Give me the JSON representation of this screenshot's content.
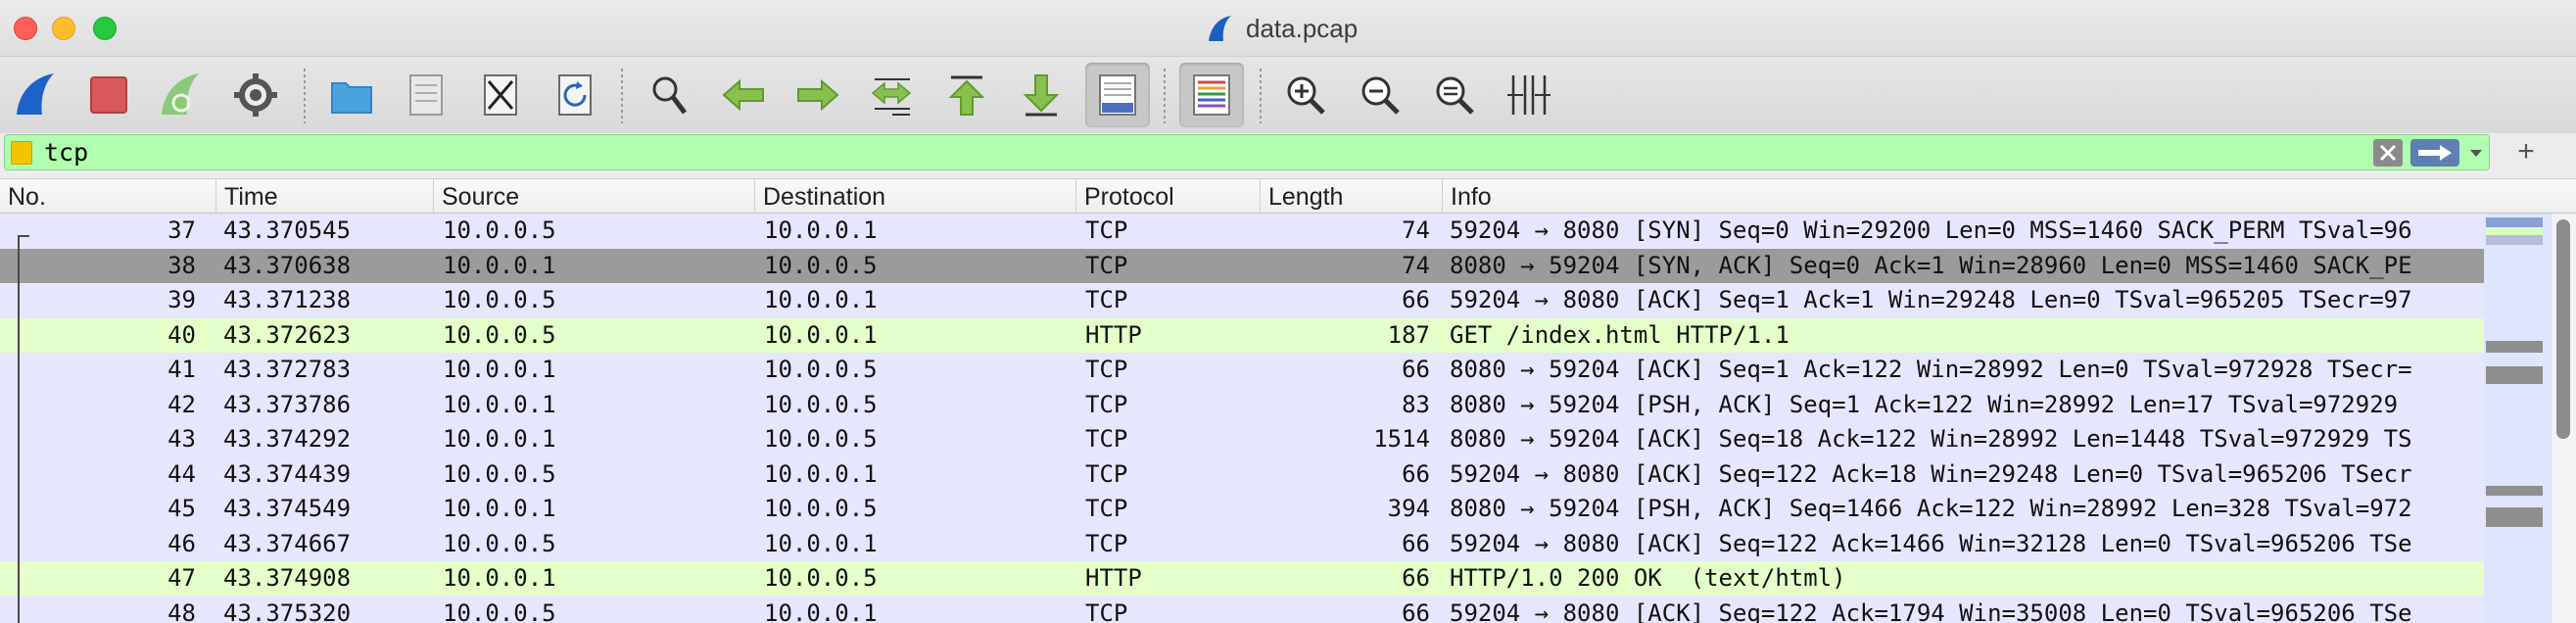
{
  "window": {
    "title": "data.pcap"
  },
  "toolbar": {
    "buttons": [
      {
        "name": "start-capture-icon"
      },
      {
        "name": "stop-capture-icon"
      },
      {
        "name": "restart-capture-icon"
      },
      {
        "name": "capture-options-icon"
      },
      {
        "name": "open-file-icon"
      },
      {
        "name": "save-file-icon"
      },
      {
        "name": "close-file-icon"
      },
      {
        "name": "reload-file-icon"
      },
      {
        "name": "find-packet-icon"
      },
      {
        "name": "go-back-icon"
      },
      {
        "name": "go-forward-icon"
      },
      {
        "name": "go-to-packet-icon"
      },
      {
        "name": "first-packet-icon"
      },
      {
        "name": "last-packet-icon"
      },
      {
        "name": "auto-scroll-icon"
      },
      {
        "name": "colorize-icon"
      },
      {
        "name": "zoom-in-icon"
      },
      {
        "name": "zoom-out-icon"
      },
      {
        "name": "normal-size-icon"
      },
      {
        "name": "resize-columns-icon"
      }
    ]
  },
  "filter": {
    "value": "tcp"
  },
  "columns": [
    "No.",
    "Time",
    "Source",
    "Destination",
    "Protocol",
    "Length",
    "Info"
  ],
  "packets": [
    {
      "no": "37",
      "time": "43.370545",
      "src": "10.0.0.5",
      "dst": "10.0.0.1",
      "proto": "TCP",
      "len": "74",
      "info": "59204 → 8080 [SYN] Seq=0 Win=29200 Len=0 MSS=1460 SACK_PERM TSval=96"
    },
    {
      "no": "38",
      "time": "43.370638",
      "src": "10.0.0.1",
      "dst": "10.0.0.5",
      "proto": "TCP",
      "len": "74",
      "info": "8080 → 59204 [SYN, ACK] Seq=0 Ack=1 Win=28960 Len=0 MSS=1460 SACK_PE"
    },
    {
      "no": "39",
      "time": "43.371238",
      "src": "10.0.0.5",
      "dst": "10.0.0.1",
      "proto": "TCP",
      "len": "66",
      "info": "59204 → 8080 [ACK] Seq=1 Ack=1 Win=29248 Len=0 TSval=965205 TSecr=97"
    },
    {
      "no": "40",
      "time": "43.372623",
      "src": "10.0.0.5",
      "dst": "10.0.0.1",
      "proto": "HTTP",
      "len": "187",
      "info": "GET /index.html HTTP/1.1"
    },
    {
      "no": "41",
      "time": "43.372783",
      "src": "10.0.0.1",
      "dst": "10.0.0.5",
      "proto": "TCP",
      "len": "66",
      "info": "8080 → 59204 [ACK] Seq=1 Ack=122 Win=28992 Len=0 TSval=972928 TSecr="
    },
    {
      "no": "42",
      "time": "43.373786",
      "src": "10.0.0.1",
      "dst": "10.0.0.5",
      "proto": "TCP",
      "len": "83",
      "info": "8080 → 59204 [PSH, ACK] Seq=1 Ack=122 Win=28992 Len=17 TSval=972929"
    },
    {
      "no": "43",
      "time": "43.374292",
      "src": "10.0.0.1",
      "dst": "10.0.0.5",
      "proto": "TCP",
      "len": "1514",
      "info": "8080 → 59204 [ACK] Seq=18 Ack=122 Win=28992 Len=1448 TSval=972929 TS"
    },
    {
      "no": "44",
      "time": "43.374439",
      "src": "10.0.0.5",
      "dst": "10.0.0.1",
      "proto": "TCP",
      "len": "66",
      "info": "59204 → 8080 [ACK] Seq=122 Ack=18 Win=29248 Len=0 TSval=965206 TSecr"
    },
    {
      "no": "45",
      "time": "43.374549",
      "src": "10.0.0.1",
      "dst": "10.0.0.5",
      "proto": "TCP",
      "len": "394",
      "info": "8080 → 59204 [PSH, ACK] Seq=1466 Ack=122 Win=28992 Len=328 TSval=972"
    },
    {
      "no": "46",
      "time": "43.374667",
      "src": "10.0.0.5",
      "dst": "10.0.0.1",
      "proto": "TCP",
      "len": "66",
      "info": "59204 → 8080 [ACK] Seq=122 Ack=1466 Win=32128 Len=0 TSval=965206 TSe"
    },
    {
      "no": "47",
      "time": "43.374908",
      "src": "10.0.0.1",
      "dst": "10.0.0.5",
      "proto": "HTTP",
      "len": "66",
      "info": "HTTP/1.0 200 OK  (text/html)"
    },
    {
      "no": "48",
      "time": "43.375320",
      "src": "10.0.0.5",
      "dst": "10.0.0.1",
      "proto": "TCP",
      "len": "66",
      "info": "59204 → 8080 [ACK] Seq=122 Ack=1794 Win=35008 Len=0 TSval=965206 TSe"
    }
  ],
  "selected_packet": "38",
  "colors": {
    "tcp_row": "#e7e6ff",
    "http_row": "#e4ffc7",
    "selected_row": "#9b9b9b",
    "filter_valid": "#afffaf"
  }
}
